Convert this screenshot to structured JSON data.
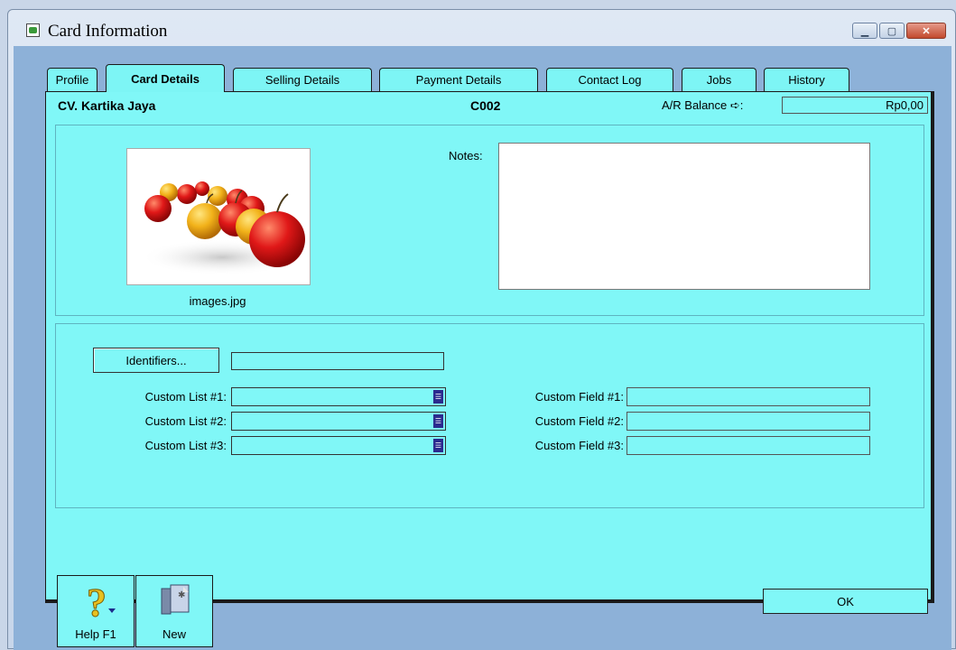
{
  "window": {
    "title": "Card Information"
  },
  "tabs": [
    {
      "label": "Profile",
      "active": false
    },
    {
      "label": "Card Details",
      "active": true
    },
    {
      "label": "Selling Details",
      "active": false
    },
    {
      "label": "Payment Details",
      "active": false
    },
    {
      "label": "Contact Log",
      "active": false
    },
    {
      "label": "Jobs",
      "active": false
    },
    {
      "label": "History",
      "active": false
    }
  ],
  "header": {
    "name": "CV. Kartika Jaya",
    "code": "C002",
    "ar_label": "A/R Balance ➪:",
    "ar_value": "Rp0,00"
  },
  "picture": {
    "caption": "images.jpg"
  },
  "notes": {
    "label": "Notes:",
    "value": ""
  },
  "identifiers": {
    "button_label": "Identifiers...",
    "value": ""
  },
  "custom_lists": [
    {
      "label": "Custom List #1:",
      "value": ""
    },
    {
      "label": "Custom List #2:",
      "value": ""
    },
    {
      "label": "Custom List #3:",
      "value": ""
    }
  ],
  "custom_fields": [
    {
      "label": "Custom Field #1:",
      "value": ""
    },
    {
      "label": "Custom Field #2:",
      "value": ""
    },
    {
      "label": "Custom Field #3:",
      "value": ""
    }
  ],
  "footer": {
    "help_label": "Help F1",
    "new_label": "New",
    "ok_label": "OK"
  },
  "colors": {
    "panel": "#80f7f7",
    "client_bg": "#8db1d8"
  }
}
